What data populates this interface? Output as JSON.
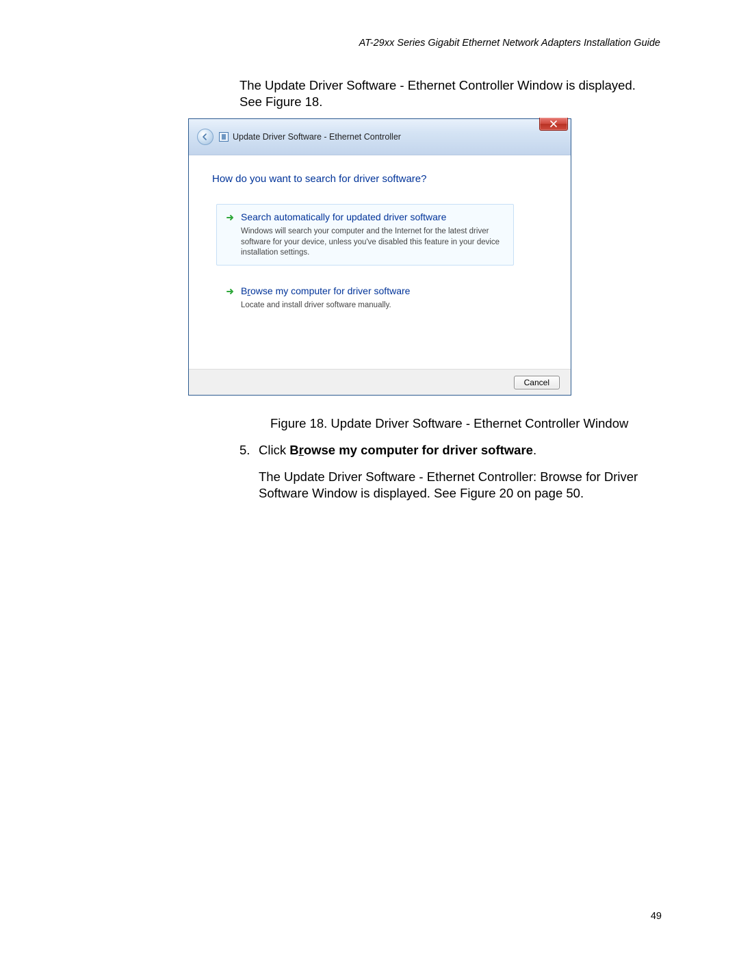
{
  "header": "AT-29xx Series Gigabit Ethernet Network Adapters Installation Guide",
  "intro": "The Update Driver Software - Ethernet Controller Window is displayed. See Figure 18.",
  "dialog": {
    "title": "Update Driver Software - Ethernet Controller",
    "question": "How do you want to search for driver software?",
    "option1": {
      "title": "Search automatically for updated driver software",
      "desc": "Windows will search your computer and the Internet for the latest driver software for your device, unless you've disabled this feature in your device installation settings."
    },
    "option2": {
      "title_pre": "B",
      "title_u": "r",
      "title_post": "owse my computer for driver software",
      "desc": "Locate and install driver software manually."
    },
    "cancel": "Cancel"
  },
  "figure_caption": "Figure 18. Update Driver Software - Ethernet Controller Window",
  "step": {
    "num": "5.",
    "pre": "Click ",
    "b_pre": "B",
    "b_u": "r",
    "b_post": "owse my computer for driver software",
    "post": "."
  },
  "para2": "The Update Driver Software - Ethernet Controller: Browse for Driver Software Window is displayed. See Figure 20 on page 50.",
  "page_number": "49"
}
